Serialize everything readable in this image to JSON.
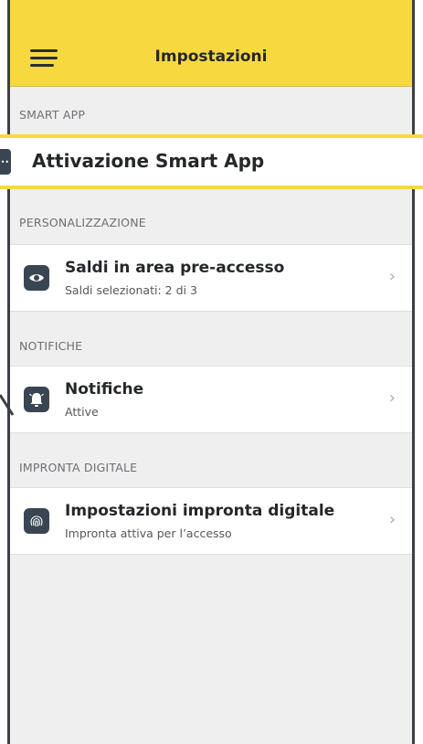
{
  "header": {
    "title": "Impostazioni",
    "background": "#f7d93f"
  },
  "sections": {
    "smart_app": {
      "label": "SMART APP",
      "highlight_title": "Attivazione Smart App"
    },
    "personalizzazione": {
      "label": "PERSONALIZZAZIONE",
      "item": {
        "title": "Saldi in area pre-accesso",
        "subtitle": "Saldi selezionati: 2 di 3",
        "icon": "eye-icon"
      }
    },
    "notifiche": {
      "label": "NOTIFICHE",
      "item": {
        "title": "Notifiche",
        "subtitle": "Attive",
        "icon": "bell-icon"
      }
    },
    "impronta": {
      "label": "IMPRONTA DIGITALE",
      "item": {
        "title": "Impostazioni impronta digitale",
        "subtitle": "Impronta attiva per l’accesso",
        "icon": "fingerprint-icon"
      }
    }
  },
  "chevron": "›"
}
